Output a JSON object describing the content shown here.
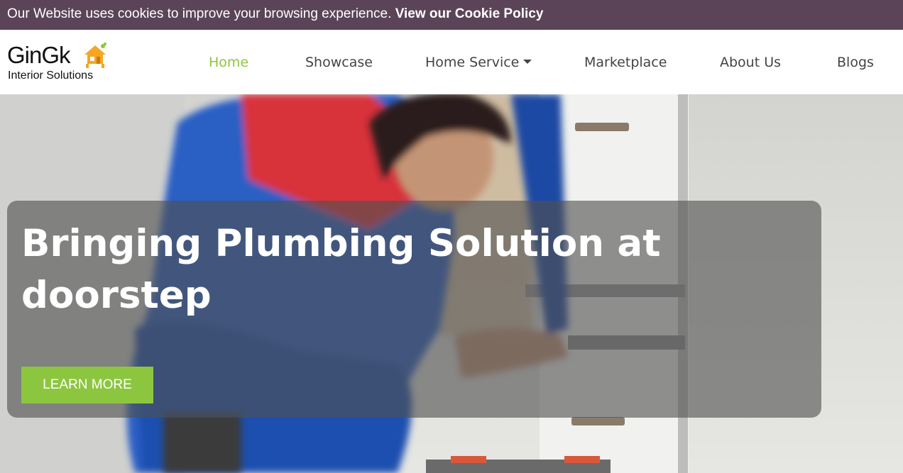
{
  "cookie_bar": {
    "message": "Our Website uses cookies to improve your browsing experience.",
    "policy_link": "View our Cookie Policy"
  },
  "logo": {
    "brand": "GinGk",
    "tagline": "Interior Solutions"
  },
  "nav": {
    "items": [
      {
        "label": "Home",
        "active": true
      },
      {
        "label": "Showcase"
      },
      {
        "label": "Home Service",
        "dropdown": true
      },
      {
        "label": "Marketplace"
      },
      {
        "label": "About Us"
      },
      {
        "label": "Blogs"
      }
    ]
  },
  "hero": {
    "title": "Bringing Plumbing Solution at doorstep",
    "button_label": "LEARN MORE"
  },
  "colors": {
    "cookie_bar_bg": "#5b4458",
    "accent_green": "#8cc63f",
    "nav_text": "#444444"
  }
}
